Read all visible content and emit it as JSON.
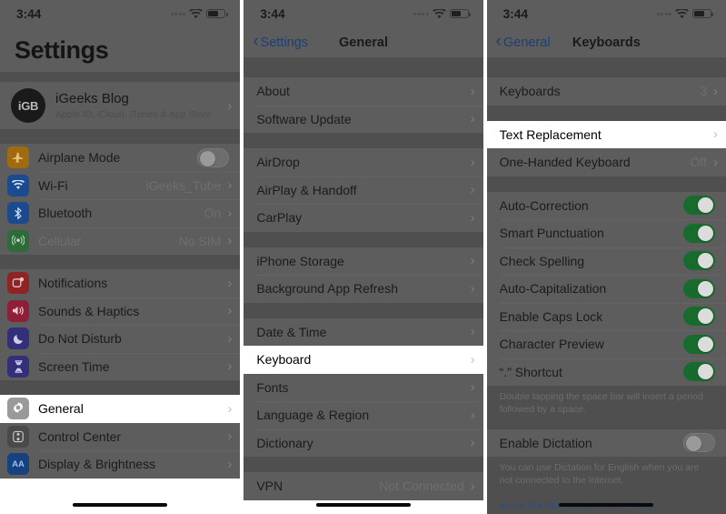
{
  "status_bar": {
    "time": "3:44",
    "wifi_icon": "wifi-icon",
    "battery_icon": "battery-icon",
    "signal_icon": "signal-dots-icon"
  },
  "panel1": {
    "title": "Settings",
    "account": {
      "avatar_text": "iGB",
      "name": "iGeeks Blog",
      "subtitle": "Apple ID, iCloud, iTunes & App Store",
      "chevron": "›"
    },
    "groups": [
      {
        "rows": [
          {
            "label": "Airplane Mode",
            "icon": "airplane-icon",
            "icon_color": "#a06a10",
            "accessory": "toggle-off"
          },
          {
            "label": "Wi-Fi",
            "icon": "wifi-icon",
            "icon_color": "#1b4a8f",
            "value": "iGeeks_Tube",
            "accessory": "chevron"
          },
          {
            "label": "Bluetooth",
            "icon": "bluetooth-icon",
            "icon_color": "#1b4a8f",
            "value": "On",
            "accessory": "chevron"
          },
          {
            "label": "Cellular",
            "icon": "cellular-icon",
            "icon_color": "#2f6b38",
            "value": "No SIM",
            "accessory": "chevron",
            "dim": true
          }
        ]
      },
      {
        "rows": [
          {
            "label": "Notifications",
            "icon": "notifications-icon",
            "icon_color": "#8e2424",
            "accessory": "chevron"
          },
          {
            "label": "Sounds & Haptics",
            "icon": "sounds-icon",
            "icon_color": "#8e1f38",
            "accessory": "chevron"
          },
          {
            "label": "Do Not Disturb",
            "icon": "moon-icon",
            "icon_color": "#332f78",
            "accessory": "chevron"
          },
          {
            "label": "Screen Time",
            "icon": "hourglass-icon",
            "icon_color": "#332f78",
            "accessory": "chevron"
          }
        ]
      },
      {
        "rows": [
          {
            "label": "General",
            "icon": "gear-icon",
            "icon_color": "#9a9a9a",
            "accessory": "chevron",
            "highlight": true
          },
          {
            "label": "Control Center",
            "icon": "control-center-icon",
            "icon_color": "#4a4a4a",
            "accessory": "chevron"
          },
          {
            "label": "Display & Brightness",
            "icon": "display-brightness-icon",
            "icon_color": "#16427f",
            "accessory": "chevron"
          }
        ]
      }
    ]
  },
  "panel2": {
    "nav": {
      "back": "Settings",
      "title": "General"
    },
    "groups": [
      {
        "rows": [
          {
            "label": "About",
            "accessory": "chevron"
          },
          {
            "label": "Software Update",
            "accessory": "chevron"
          }
        ]
      },
      {
        "rows": [
          {
            "label": "AirDrop",
            "accessory": "chevron"
          },
          {
            "label": "AirPlay & Handoff",
            "accessory": "chevron"
          },
          {
            "label": "CarPlay",
            "accessory": "chevron"
          }
        ]
      },
      {
        "rows": [
          {
            "label": "iPhone Storage",
            "accessory": "chevron"
          },
          {
            "label": "Background App Refresh",
            "accessory": "chevron"
          }
        ]
      },
      {
        "rows": [
          {
            "label": "Date & Time",
            "accessory": "chevron"
          },
          {
            "label": "Keyboard",
            "accessory": "chevron",
            "highlight": true
          },
          {
            "label": "Fonts",
            "accessory": "chevron"
          },
          {
            "label": "Language & Region",
            "accessory": "chevron"
          },
          {
            "label": "Dictionary",
            "accessory": "chevron"
          }
        ]
      },
      {
        "rows": [
          {
            "label": "VPN",
            "value": "Not Connected",
            "accessory": "chevron"
          }
        ]
      }
    ]
  },
  "panel3": {
    "nav": {
      "back": "General",
      "title": "Keyboards"
    },
    "groups": [
      {
        "rows": [
          {
            "label": "Keyboards",
            "value": "3",
            "accessory": "chevron"
          }
        ]
      },
      {
        "rows": [
          {
            "label": "Text Replacement",
            "accessory": "chevron",
            "highlight": true
          },
          {
            "label": "One-Handed Keyboard",
            "value": "Off",
            "accessory": "chevron"
          }
        ]
      },
      {
        "rows": [
          {
            "label": "Auto-Correction",
            "accessory": "toggle-on"
          },
          {
            "label": "Smart Punctuation",
            "accessory": "toggle-on"
          },
          {
            "label": "Check Spelling",
            "accessory": "toggle-on"
          },
          {
            "label": "Auto-Capitalization",
            "accessory": "toggle-on"
          },
          {
            "label": "Enable Caps Lock",
            "accessory": "toggle-on"
          },
          {
            "label": "Character Preview",
            "accessory": "toggle-on"
          },
          {
            "label": "“.” Shortcut",
            "accessory": "toggle-on"
          }
        ],
        "note": "Double tapping the space bar will insert a period followed by a space."
      },
      {
        "rows": [
          {
            "label": "Enable Dictation",
            "accessory": "toggle-off"
          }
        ],
        "note": "You can use Dictation for English when you are not connected to the Internet.",
        "link": "About Ask Siri, Dictation and Privacy..."
      }
    ]
  },
  "colors": {
    "toggle_on": "#176b2c",
    "link_blue": "#2a4f87",
    "dim_background": "#5d5d5d",
    "group_gap": "#4f4f4f",
    "highlight_background": "#ffffff"
  }
}
